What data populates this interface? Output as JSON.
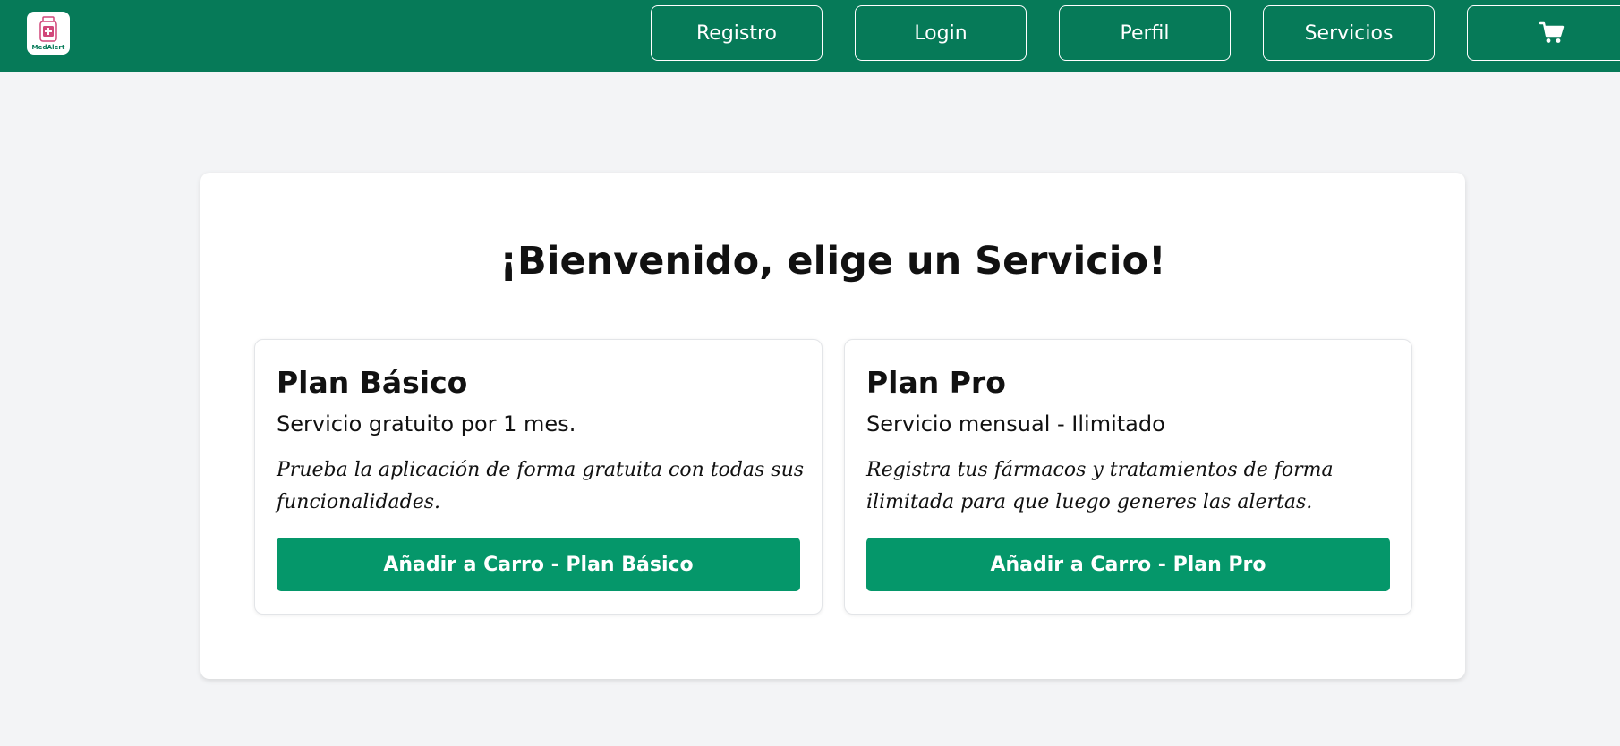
{
  "header": {
    "logo_text": "MedAlert",
    "nav": {
      "registro": "Registro",
      "login": "Login",
      "perfil": "Perfil",
      "servicios": "Servicios"
    },
    "cart_icon": "shopping-cart-icon"
  },
  "main": {
    "title": "¡Bienvenido, elige un Servicio!",
    "plans": [
      {
        "name": "Plan Básico",
        "subtitle": "Servicio gratuito por 1 mes.",
        "description": "Prueba la aplicación de forma gratuita con todas sus funcionalidades.",
        "button": "Añadir a Carro - Plan Básico"
      },
      {
        "name": "Plan Pro",
        "subtitle": "Servicio mensual - Ilimitado",
        "description": "Registra tus fármacos y tratamientos de forma ilimitada para que luego generes las alertas.",
        "button": "Añadir a Carro - Plan Pro"
      }
    ]
  },
  "colors": {
    "navbar": "#067a58",
    "button": "#05976a",
    "background": "#f3f4f6"
  }
}
